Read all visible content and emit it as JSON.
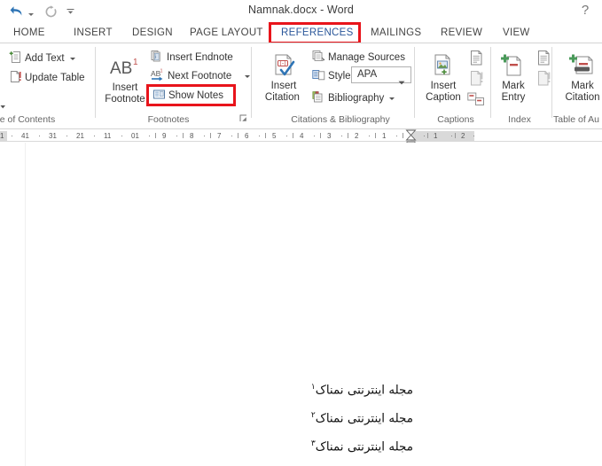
{
  "window": {
    "title": "Namnak.docx - Word",
    "help_icon": "?",
    "quick_access": [
      {
        "name": "undo-icon",
        "glyph": "↶"
      },
      {
        "name": "redo-icon",
        "glyph": "↺"
      },
      {
        "name": "customize-quick-access-toolbar-icon",
        "glyph": "▾"
      }
    ]
  },
  "tabs": [
    {
      "label": "HOME",
      "active": false
    },
    {
      "label": "INSERT",
      "active": false
    },
    {
      "label": "DESIGN",
      "active": false
    },
    {
      "label": "PAGE LAYOUT",
      "active": false
    },
    {
      "label": "REFERENCES",
      "active": true
    },
    {
      "label": "MAILINGS",
      "active": false
    },
    {
      "label": "REVIEW",
      "active": false
    },
    {
      "label": "VIEW",
      "active": false
    }
  ],
  "highlights": {
    "color": "#e8141b",
    "references_tab": "REFERENCES",
    "show_notes_button": "Show Notes"
  },
  "ribbon": {
    "groups": [
      {
        "name": "table-of-contents",
        "label": "e of Contents",
        "full_label": "Table of Contents",
        "commands": [
          {
            "label": "Add Text",
            "icon": "add-text-icon",
            "dropdown": true
          },
          {
            "label": "Update Table",
            "icon": "update-table-icon",
            "dropdown": false
          }
        ]
      },
      {
        "name": "footnotes",
        "label": "Footnotes",
        "commands": [
          {
            "label": "Insert Footnote",
            "icon": "insert-footnote-icon",
            "dropdown": false
          },
          {
            "label": "Insert Endnote",
            "icon": "insert-endnote-icon",
            "dropdown": false
          },
          {
            "label": "Next Footnote",
            "icon": "next-footnote-icon",
            "dropdown": true
          },
          {
            "label": "Show Notes",
            "icon": "show-notes-icon",
            "dropdown": false
          }
        ]
      },
      {
        "name": "citations-and-bibliography",
        "label": "Citations & Bibliography",
        "commands": [
          {
            "label": "Insert Citation",
            "icon": "insert-citation-icon",
            "dropdown": true
          },
          {
            "label": "Manage Sources",
            "icon": "manage-sources-icon",
            "dropdown": false
          },
          {
            "label": "Style:",
            "icon": "style-icon",
            "dropdown": false
          },
          {
            "label": "Bibliography",
            "icon": "bibliography-icon",
            "dropdown": true
          }
        ],
        "style_dropdown": {
          "value": "APA"
        }
      },
      {
        "name": "captions",
        "label": "Captions",
        "commands": [
          {
            "label": "Insert Caption",
            "icon": "insert-caption-icon"
          },
          {
            "label": "Insert Table of Figures",
            "icon": "insert-table-of-figures-icon"
          },
          {
            "label": "Update Table",
            "icon": "update-table-small-icon"
          },
          {
            "label": "Cross-reference",
            "icon": "cross-reference-icon"
          }
        ]
      },
      {
        "name": "index",
        "label": "Index",
        "commands": [
          {
            "label": "Mark Entry",
            "icon": "mark-entry-icon"
          },
          {
            "label": "Insert Index",
            "icon": "insert-index-icon"
          },
          {
            "label": "Update Index",
            "icon": "update-index-icon"
          }
        ]
      },
      {
        "name": "table-of-authorities",
        "label": "Table of Au",
        "full_label": "Table of Authorities",
        "commands": [
          {
            "label": "Mark Citation",
            "icon": "mark-citation-icon"
          }
        ]
      }
    ]
  },
  "ruler": {
    "orientation": "rtl",
    "ticks": [
      "1",
      "41",
      "31",
      "21",
      "11",
      "01",
      "9",
      "8",
      "7",
      "6",
      "5",
      "4",
      "3",
      "2",
      "1",
      "1",
      "2"
    ]
  },
  "document": {
    "lines": [
      {
        "text": "مجله اینترنتی نمناک",
        "footnote_mark": "۱"
      },
      {
        "text": "مجله اینترنتی نمناک",
        "footnote_mark": "۲"
      },
      {
        "text": "مجله اینترنتی نمناک",
        "footnote_mark": "۳"
      }
    ]
  }
}
